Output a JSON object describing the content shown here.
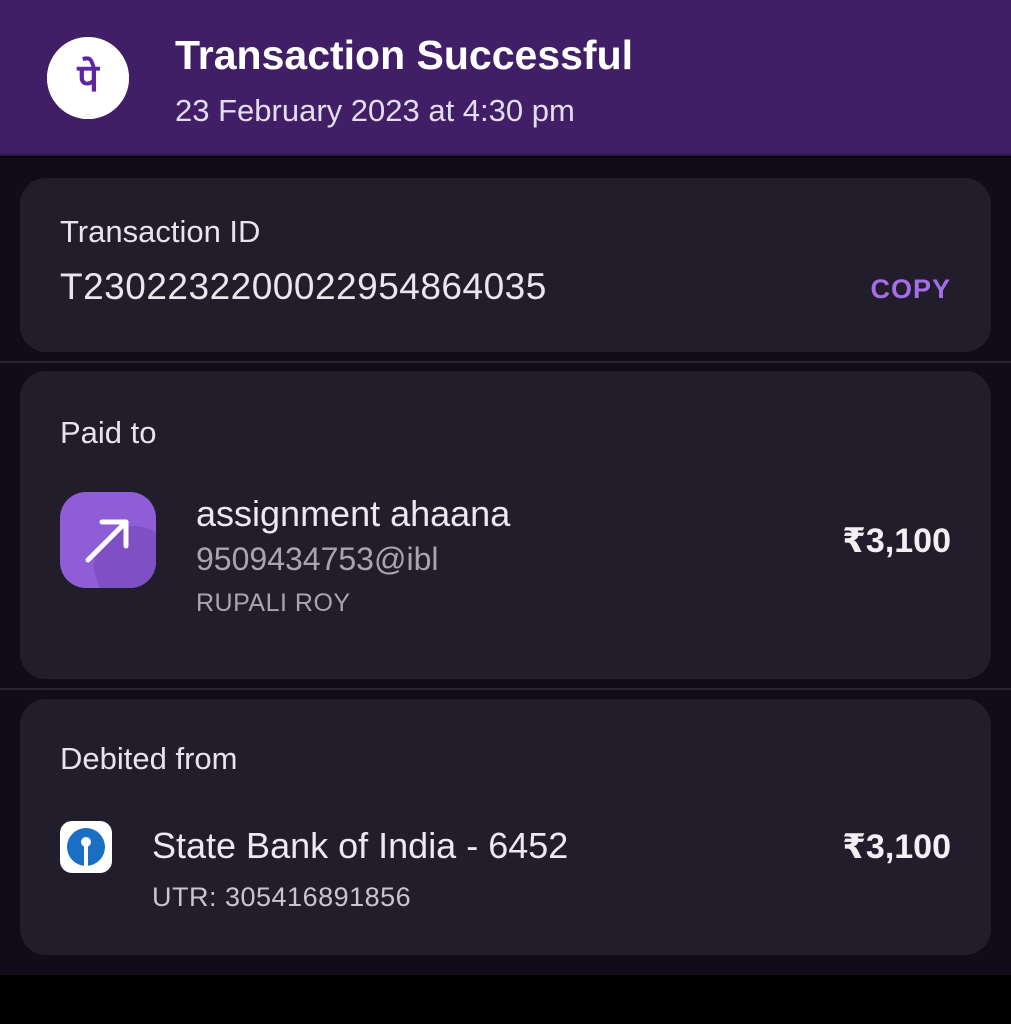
{
  "header": {
    "logo_glyph": "पे",
    "title": "Transaction Successful",
    "datetime": "23 February 2023 at 4:30 pm"
  },
  "transaction": {
    "label": "Transaction ID",
    "id": "T2302232200022954864035",
    "copy_label": "COPY"
  },
  "paid_to": {
    "label": "Paid to",
    "icon": "arrow-up-right-icon",
    "name": "assignment ahaana",
    "upi_id": "9509434753@ibl",
    "account_holder": "RUPALI ROY",
    "amount": "₹3,100"
  },
  "debited_from": {
    "label": "Debited from",
    "icon": "sbi-bank-icon",
    "bank": "State Bank of India - 6452",
    "utr": "UTR: 305416891856",
    "amount": "₹3,100"
  },
  "colors": {
    "header_bg": "#401f66",
    "card_bg": "#221d2a",
    "accent": "#a46ee8",
    "payee_icon_bg": "#8f5ed6",
    "sbi_blue": "#1a6fc4"
  }
}
